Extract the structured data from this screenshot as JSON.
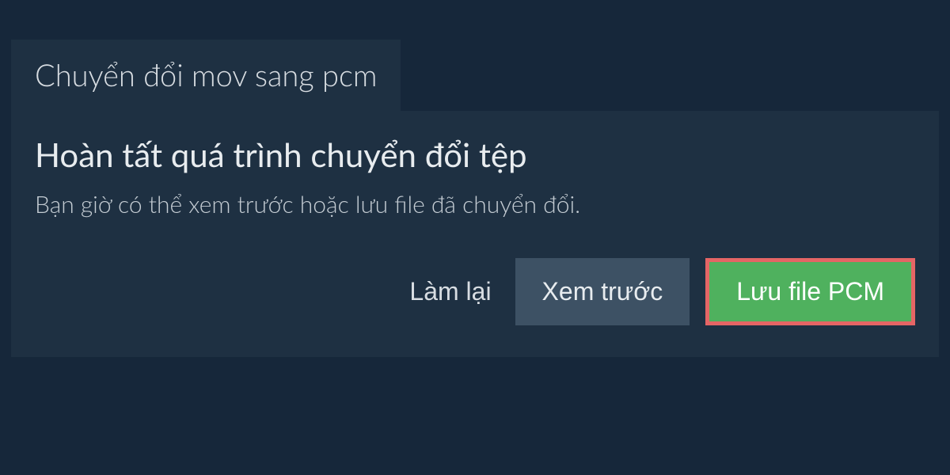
{
  "tab": {
    "label": "Chuyển đổi mov sang pcm"
  },
  "content": {
    "heading": "Hoàn tất quá trình chuyển đổi tệp",
    "description": "Bạn giờ có thể xem trước hoặc lưu file đã chuyển đổi."
  },
  "buttons": {
    "redo_label": "Làm lại",
    "preview_label": "Xem trước",
    "save_label": "Lưu file PCM"
  }
}
